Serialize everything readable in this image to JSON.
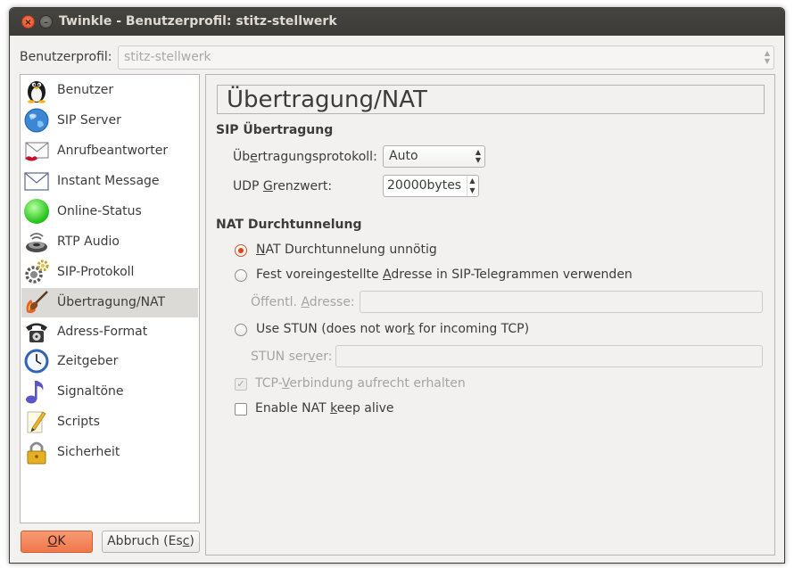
{
  "window": {
    "title": "Twinkle - Benutzerprofil: stitz-stellwerk",
    "close_glyph": "×",
    "minimize_glyph": "–"
  },
  "profile": {
    "label": "Benutzerprofil:",
    "value": "stitz-stellwerk"
  },
  "sidebar": {
    "items": [
      {
        "label": "Benutzer",
        "icon": "penguin-icon"
      },
      {
        "label": "SIP Server",
        "icon": "globe-icon"
      },
      {
        "label": "Anrufbeantworter",
        "icon": "mail-lips-icon"
      },
      {
        "label": "Instant Message",
        "icon": "envelope-icon"
      },
      {
        "label": "Online-Status",
        "icon": "green-circle-icon"
      },
      {
        "label": "RTP Audio",
        "icon": "speaker-icon"
      },
      {
        "label": "SIP-Protokoll",
        "icon": "gears-icon"
      },
      {
        "label": "Übertragung/NAT",
        "icon": "guitar-flames-icon"
      },
      {
        "label": "Adress-Format",
        "icon": "telephone-icon"
      },
      {
        "label": "Zeitgeber",
        "icon": "clock-icon"
      },
      {
        "label": "Signaltöne",
        "icon": "music-note-icon"
      },
      {
        "label": "Scripts",
        "icon": "pencil-paper-icon"
      },
      {
        "label": "Sicherheit",
        "icon": "padlock-icon"
      }
    ],
    "selected_index": 7
  },
  "content": {
    "heading": "Übertragung/NAT",
    "sip": {
      "section_title": "SIP Übertragung",
      "protocol_label_pre": "Üb",
      "protocol_label_u": "e",
      "protocol_label_post": "rtragungsprotokoll:",
      "protocol_value": "Auto",
      "udp_label_pre": "UDP ",
      "udp_label_u": "G",
      "udp_label_post": "renzwert:",
      "udp_value": "20000bytes"
    },
    "nat": {
      "section_title": "NAT Durchtunnelung",
      "radio1_u": "N",
      "radio1_post": "AT Durchtunnelung unnötig",
      "radio2_pre": "Fest voreingestellte ",
      "radio2_u": "A",
      "radio2_post": "dresse in SIP-Telegrammen verwenden",
      "public_addr_pre": "Öffentl. ",
      "public_addr_u": "A",
      "public_addr_post": "dresse:",
      "public_addr_value": "",
      "radio3_pre": "Use STUN (does not wor",
      "radio3_u": "k",
      "radio3_post": " for incoming TCP)",
      "stun_pre": "STUN ser",
      "stun_u": "v",
      "stun_post": "er:",
      "stun_value": "",
      "tcp_pre": "TCP-",
      "tcp_u": "V",
      "tcp_post": "erbindung aufrecht erhalten",
      "keepalive_pre": "Enable NAT ",
      "keepalive_u": "k",
      "keepalive_post": "eep alive",
      "check_glyph": "✓"
    }
  },
  "buttons": {
    "ok_u": "O",
    "ok_post": "K",
    "cancel_pre": "Abbruch (Es",
    "cancel_u": "c",
    "cancel_post": ")"
  },
  "colors": {
    "accent": "#f1774b",
    "radio_selected": "#dd4814",
    "titlebar": "#3c3b37"
  }
}
